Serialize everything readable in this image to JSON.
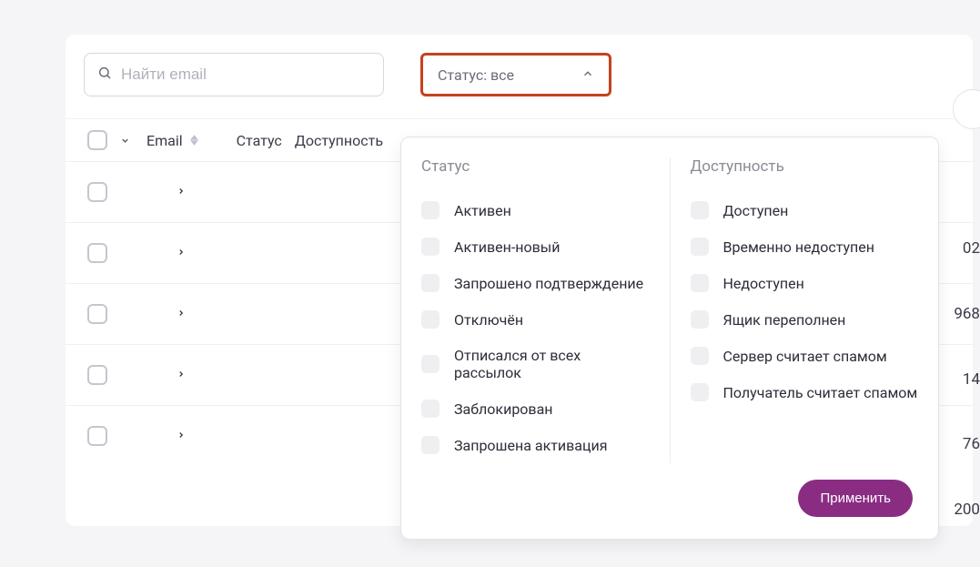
{
  "search": {
    "placeholder": "Найти email"
  },
  "statusDropdown": {
    "label": "Статус: все"
  },
  "columns": {
    "email": "Email",
    "status": "Статус",
    "availability": "Доступность"
  },
  "rows": [
    {
      "tail": "02"
    },
    {
      "tail": "968"
    },
    {
      "tail": "14"
    },
    {
      "tail": "76"
    },
    {
      "tail": "200"
    }
  ],
  "filterPanel": {
    "statusTitle": "Статус",
    "availabilityTitle": "Доступность",
    "statusOptions": [
      "Активен",
      "Активен-новый",
      "Запрошено подтверждение",
      "Отключён",
      "Отписался от всех рассылок",
      "Заблокирован",
      "Запрошена активация"
    ],
    "availabilityOptions": [
      "Доступен",
      "Временно недоступен",
      "Недоступен",
      "Ящик переполнен",
      "Сервер считает спамом",
      "Получатель считает спамом"
    ],
    "applyLabel": "Применить"
  }
}
